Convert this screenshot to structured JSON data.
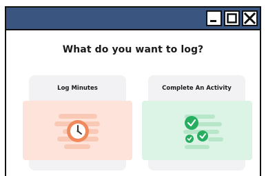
{
  "dialog": {
    "heading": "What do you want to log?",
    "options": [
      {
        "label": "Log Minutes",
        "icon": "clock-icon",
        "accent": "#f08a5d",
        "panel": "#fde3da"
      },
      {
        "label": "Complete An Activity",
        "icon": "checkmarks-icon",
        "accent": "#27ae60",
        "panel": "#dcf4e6"
      }
    ]
  },
  "window": {
    "titlebar_color": "#3a5580",
    "controls": [
      "minimize-icon",
      "maximize-icon",
      "close-icon"
    ]
  }
}
